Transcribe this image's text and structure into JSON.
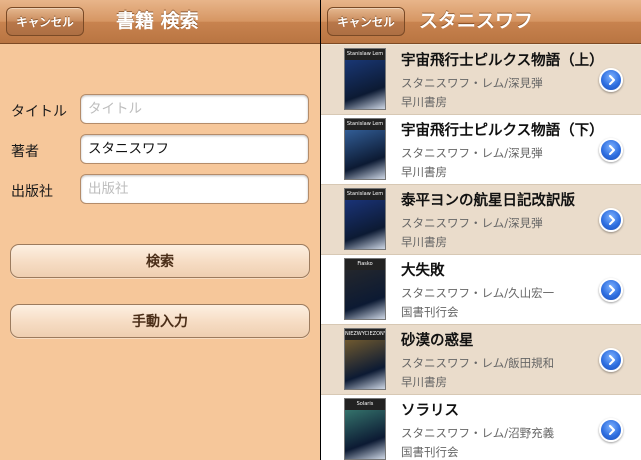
{
  "left": {
    "nav": {
      "cancel_label": "キャンセル",
      "title": "書籍 検索"
    },
    "fields": [
      {
        "label": "タイトル",
        "value": "",
        "placeholder": "タイトル"
      },
      {
        "label": "著者",
        "value": "スタニスワフ",
        "placeholder": ""
      },
      {
        "label": "出版社",
        "value": "",
        "placeholder": "出版社"
      }
    ],
    "search_button": "検索",
    "manual_button": "手動入力"
  },
  "right": {
    "nav": {
      "cancel_label": "キャンセル",
      "title": "スタニスワフ"
    },
    "books": [
      {
        "title": "宇宙飛行士ピルクス物語（上）",
        "author": "スタニスワフ・レム/深見弾",
        "publisher": "早川書房",
        "cover_label": "Stanislaw Lem",
        "cover_color": "#1d3f86"
      },
      {
        "title": "宇宙飛行士ピルクス物語（下）",
        "author": "スタニスワフ・レム/深見弾",
        "publisher": "早川書房",
        "cover_label": "Stanislaw Lem",
        "cover_color": "#3c6fb0"
      },
      {
        "title": "泰平ヨンの航星日記改訳版",
        "author": "スタニスワフ・レム/深見弾",
        "publisher": "早川書房",
        "cover_label": "Stanislaw Lem",
        "cover_color": "#1e3a8a"
      },
      {
        "title": "大失敗",
        "author": "スタニスワフ・レム/久山宏一",
        "publisher": "国書刊行会",
        "cover_label": "Fiasko",
        "cover_color": "#2a2a2a"
      },
      {
        "title": "砂漠の惑星",
        "author": "スタニスワフ・レム/飯田規和",
        "publisher": "早川書房",
        "cover_label": "NIEZWYCIEZONY",
        "cover_color": "#8a6a2e"
      },
      {
        "title": "ソラリス",
        "author": "スタニスワフ・レム/沼野充義",
        "publisher": "国書刊行会",
        "cover_label": "Solaris",
        "cover_color": "#3f8a7a"
      }
    ]
  }
}
